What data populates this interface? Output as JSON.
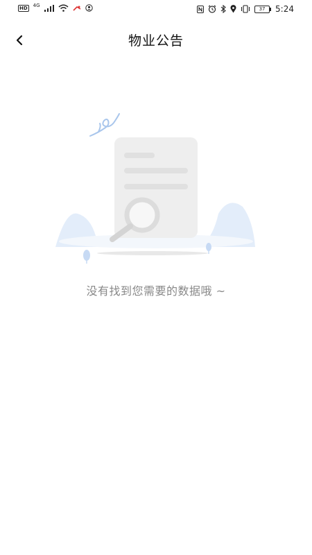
{
  "status_bar": {
    "hd_badge": "HD",
    "network": "4G",
    "battery": "37",
    "time": "5:24",
    "left_icons": [
      "hd-icon",
      "signal-icon",
      "wifi-icon",
      "notification-icon",
      "account-icon"
    ],
    "right_icons": [
      "nfc-icon",
      "alarm-icon",
      "bluetooth-icon",
      "location-icon",
      "vibrate-icon",
      "battery-icon"
    ]
  },
  "header": {
    "title": "物业公告",
    "back_icon": "chevron-left-icon"
  },
  "empty_state": {
    "message": "没有找到您需要的数据哦 ~",
    "illustration": "empty-document-search"
  },
  "colors": {
    "background": "#ffffff",
    "title_text": "#111111",
    "empty_text": "#888888",
    "illustration_blue": "#dce8f8",
    "illustration_gray": "#ededed"
  }
}
